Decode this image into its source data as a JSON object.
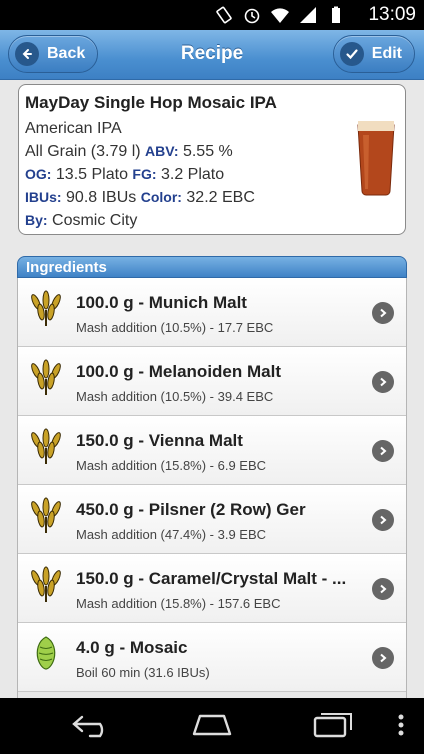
{
  "status_bar": {
    "time": "13:09"
  },
  "header": {
    "title": "Recipe",
    "back_label": "Back",
    "edit_label": "Edit"
  },
  "recipe": {
    "name": "MayDay Single Hop Mosaic IPA",
    "style": "American IPA",
    "method": "All Grain (3.79 l)",
    "abv_label": "ABV:",
    "abv": "5.55 %",
    "og_label": "OG:",
    "og": "13.5 Plato",
    "fg_label": "FG:",
    "fg": "3.2 Plato",
    "ibu_label": "IBUs:",
    "ibu": "90.8 IBUs",
    "color_label": "Color:",
    "color": "32.2 EBC",
    "by_label": "By:",
    "by": "Cosmic City"
  },
  "ingredients": {
    "title": "Ingredients",
    "items": [
      {
        "title": "100.0 g - Munich Malt",
        "detail": "Mash addition (10.5%) - 17.7 EBC",
        "icon": "grain-icon"
      },
      {
        "title": "100.0 g - Melanoiden Malt",
        "detail": "Mash addition (10.5%) - 39.4 EBC",
        "icon": "grain-icon"
      },
      {
        "title": "150.0 g - Vienna Malt",
        "detail": "Mash addition (15.8%) - 6.9 EBC",
        "icon": "grain-icon"
      },
      {
        "title": "450.0 g - Pilsner (2 Row) Ger",
        "detail": "Mash addition (47.4%) - 3.9 EBC",
        "icon": "grain-icon"
      },
      {
        "title": "150.0 g - Caramel/Crystal Malt - ...",
        "detail": "Mash addition (15.8%) - 157.6 EBC",
        "icon": "grain-icon"
      },
      {
        "title": "4.0 g - Mosaic",
        "detail": "Boil 60 min (31.6 IBUs)",
        "icon": "hop-icon"
      }
    ]
  },
  "colors": {
    "accent": "#4a8fd0",
    "label": "#23408e"
  }
}
